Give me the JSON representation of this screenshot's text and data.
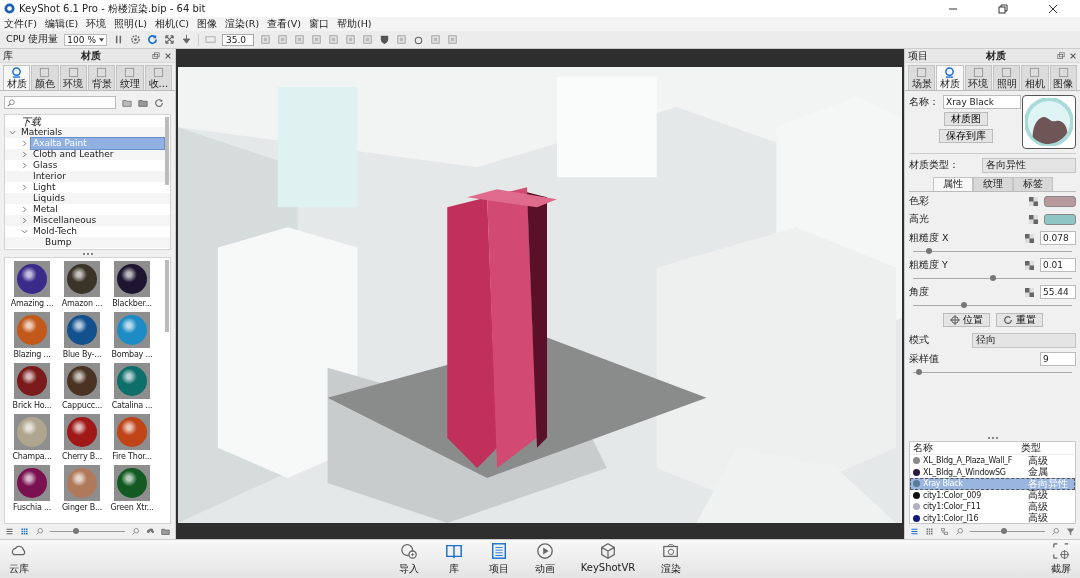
{
  "window": {
    "title": "KeyShot 6.1 Pro  - 粉楼渲染.bip  - 64 bit"
  },
  "menu": [
    "文件(F)",
    "编辑(E)",
    "环境",
    "照明(L)",
    "相机(C)",
    "图像",
    "渲染(R)",
    "查看(V)",
    "窗口",
    "帮助(H)"
  ],
  "toolbar": {
    "cpu_label": "CPU 使用量",
    "cpu_value": "100 %",
    "focal_value": "35.0"
  },
  "library": {
    "header": "库",
    "title": "材质",
    "tabs": [
      {
        "label": "材质",
        "selected": true
      },
      {
        "label": "颜色",
        "selected": false
      },
      {
        "label": "环境",
        "selected": false
      },
      {
        "label": "背景",
        "selected": false
      },
      {
        "label": "纹理",
        "selected": false
      },
      {
        "label": "收...",
        "selected": false
      }
    ],
    "tree": [
      {
        "label": "下载",
        "kind": "shortcut",
        "selected": false
      },
      {
        "label": "Materials",
        "kind": "folder",
        "expanded": true,
        "selected": false,
        "children": [
          {
            "label": "Axalta Paint",
            "kind": "folder",
            "expanded": false,
            "selected": true
          },
          {
            "label": "Cloth and Leather",
            "kind": "folder",
            "expanded": false,
            "selected": false
          },
          {
            "label": "Glass",
            "kind": "folder",
            "expanded": false,
            "selected": false
          },
          {
            "label": "Interior",
            "kind": "folder",
            "selected": false
          },
          {
            "label": "Light",
            "kind": "folder",
            "expanded": false,
            "selected": false
          },
          {
            "label": "Liquids",
            "kind": "folder",
            "selected": false
          },
          {
            "label": "Metal",
            "kind": "folder",
            "expanded": false,
            "selected": false
          },
          {
            "label": "Miscellaneous",
            "kind": "folder",
            "expanded": false,
            "selected": false
          },
          {
            "label": "Mold-Tech",
            "kind": "folder",
            "expanded": true,
            "selected": false,
            "children": [
              {
                "label": "Bump",
                "kind": "folder",
                "selected": false
              }
            ]
          }
        ]
      }
    ],
    "thumbnails": [
      {
        "label": "Amazing ...",
        "color": "#3a2a8a"
      },
      {
        "label": "Amazon ...",
        "color": "#3a3328"
      },
      {
        "label": "Blackber...",
        "color": "#1e1630"
      },
      {
        "label": "Blazing ...",
        "color": "#c2581a"
      },
      {
        "label": "Blue By-...",
        "color": "#12508e"
      },
      {
        "label": "Bombay ...",
        "color": "#1e8cc4"
      },
      {
        "label": "Brick Ho...",
        "color": "#7a1a1a"
      },
      {
        "label": "Cappucc...",
        "color": "#4a3322"
      },
      {
        "label": "Catalina ...",
        "color": "#0e6e6a"
      },
      {
        "label": "Champa...",
        "color": "#b0a690"
      },
      {
        "label": "Cherry B...",
        "color": "#a01818"
      },
      {
        "label": "Fire Thor...",
        "color": "#c04418"
      },
      {
        "label": "Fuschia ...",
        "color": "#7a1050"
      },
      {
        "label": "Ginger B...",
        "color": "#b07a5a"
      },
      {
        "label": "Green Xtr...",
        "color": "#125a22"
      }
    ],
    "thumb_size": {
      "level": 0.35
    }
  },
  "project": {
    "header": "项目",
    "title": "材质",
    "tabs": [
      {
        "label": "场景",
        "selected": false
      },
      {
        "label": "材质",
        "selected": true
      },
      {
        "label": "环境",
        "selected": false
      },
      {
        "label": "照明",
        "selected": false
      },
      {
        "label": "相机",
        "selected": false
      },
      {
        "label": "图像",
        "selected": false
      }
    ],
    "name_label": "名称：",
    "name_value": "Xray Black",
    "graph_button": "材质图",
    "save_button": "保存到库",
    "type_label": "材质类型：",
    "type_value": "各向异性",
    "subtabs": [
      {
        "label": "属性",
        "selected": true
      },
      {
        "label": "纹理",
        "selected": false
      },
      {
        "label": "标签",
        "selected": false
      }
    ],
    "properties": [
      {
        "kind": "color",
        "label": "色彩",
        "color": "#b89a9c"
      },
      {
        "kind": "color",
        "label": "高光",
        "color": "#8ec4c4"
      },
      {
        "kind": "slider",
        "label": "粗糙度 X",
        "value": "0.078",
        "level": 0.1
      },
      {
        "kind": "slider",
        "label": "粗糙度 Y",
        "value": "0.01",
        "level": 0.5
      },
      {
        "kind": "slider",
        "label": "角度",
        "value": "55.44",
        "level": 0.32
      }
    ],
    "position_button": "位置",
    "reset_button": "重置",
    "mode_label": "模式",
    "mode_value": "径向",
    "samples": {
      "label": "采样值",
      "value": "9",
      "level": 0.04
    },
    "list_columns": [
      "名称",
      "类型"
    ],
    "list_rows": [
      {
        "name": "XL_Bldg_A_Plaza_Wall_F",
        "type": "高级",
        "color": "#8a8a8a",
        "selected": false
      },
      {
        "name": "XL_Bldg_A_WindowSG",
        "type": "金属",
        "color": "#2a1a3a",
        "selected": false
      },
      {
        "name": "Xray Black",
        "type": "各向异性",
        "color": "#5a7a9a",
        "selected": true
      },
      {
        "name": "city1:Color_009",
        "type": "高级",
        "color": "#101010",
        "selected": false
      },
      {
        "name": "city1:Color_F11",
        "type": "高级",
        "color": "#b0b0c0",
        "selected": false
      },
      {
        "name": "city1:Color_I16",
        "type": "高级",
        "color": "#101a7a",
        "selected": false
      }
    ],
    "list_zoom": {
      "level": 0.45
    }
  },
  "dock": [
    {
      "label": "云库",
      "selected": false
    },
    {
      "label": "导入",
      "selected": false
    },
    {
      "label": "库",
      "selected": true
    },
    {
      "label": "项目",
      "selected": true
    },
    {
      "label": "动画",
      "selected": false
    },
    {
      "label": "KeyShotVR",
      "selected": false
    },
    {
      "label": "渲染",
      "selected": false
    },
    {
      "label": "截屏",
      "selected": false
    }
  ]
}
